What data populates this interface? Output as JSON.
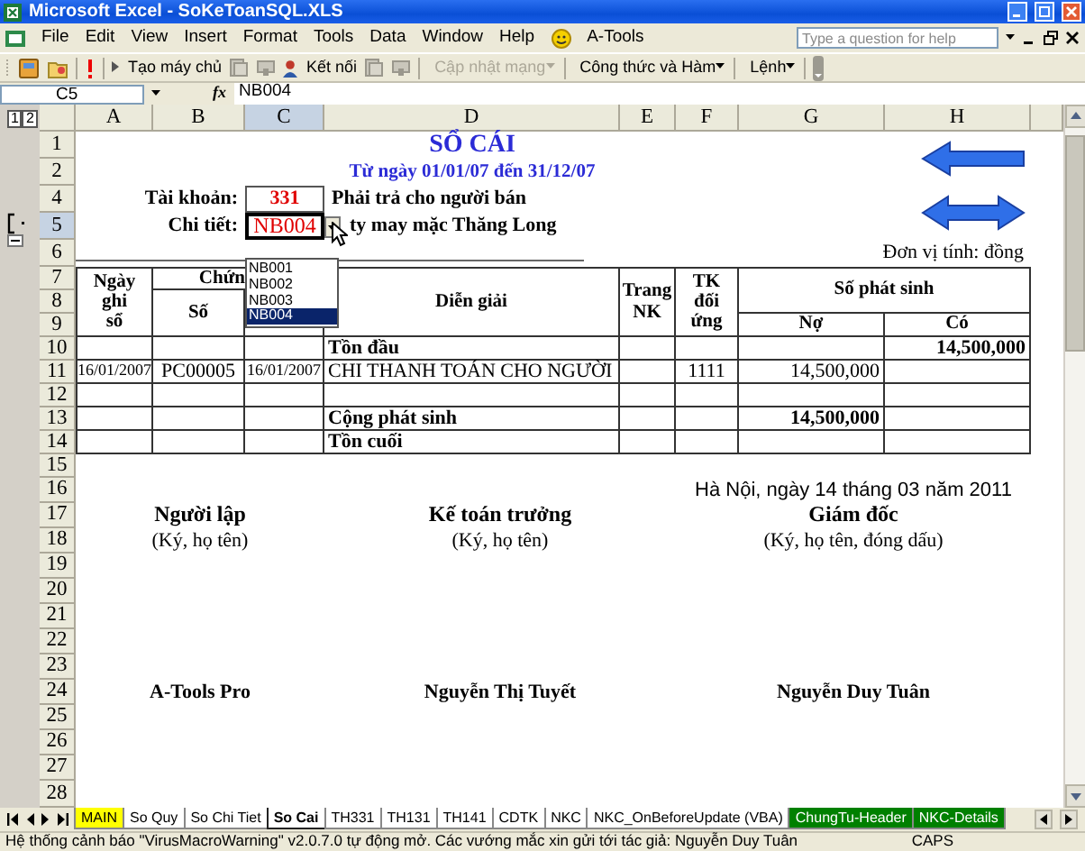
{
  "window": {
    "title": "Microsoft Excel - SoKeToanSQL.XLS"
  },
  "menu": [
    "File",
    "Edit",
    "View",
    "Insert",
    "Format",
    "Tools",
    "Data",
    "Window",
    "Help",
    "A-Tools"
  ],
  "help_box": {
    "placeholder": "Type a question for help"
  },
  "toolbar": [
    {
      "kind": "button",
      "label": "Tạo máy chủ",
      "disabled": false
    },
    {
      "kind": "button",
      "label": "Kết nối",
      "disabled": false
    },
    {
      "kind": "dropdown",
      "label": "Cập nhật mạng",
      "disabled": true
    },
    {
      "kind": "dropdown",
      "label": "Công thức và Hàm",
      "disabled": false
    },
    {
      "kind": "dropdown",
      "label": "Lệnh",
      "disabled": false
    }
  ],
  "formula_bar": {
    "name_box": "C5",
    "fx_label": "fx",
    "formula": "NB004"
  },
  "outline_levels": [
    "1",
    "2"
  ],
  "columns": [
    {
      "label": "A",
      "selected": false
    },
    {
      "label": "B",
      "selected": false
    },
    {
      "label": "C",
      "selected": true
    },
    {
      "label": "D",
      "selected": false
    },
    {
      "label": "E",
      "selected": false
    },
    {
      "label": "F",
      "selected": false
    },
    {
      "label": "G",
      "selected": false
    },
    {
      "label": "H",
      "selected": false
    }
  ],
  "rows": [
    {
      "label": "1",
      "selected": false
    },
    {
      "label": "2",
      "selected": false
    },
    {
      "label": "4",
      "selected": false
    },
    {
      "label": "5",
      "selected": true
    },
    {
      "label": "6",
      "selected": false
    },
    {
      "label": "7",
      "selected": false
    },
    {
      "label": "8",
      "selected": false
    },
    {
      "label": "9",
      "selected": false
    },
    {
      "label": "10",
      "selected": false
    },
    {
      "label": "11",
      "selected": false
    },
    {
      "label": "12",
      "selected": false
    },
    {
      "label": "13",
      "selected": false
    },
    {
      "label": "14",
      "selected": false
    },
    {
      "label": "15",
      "selected": false
    },
    {
      "label": "16",
      "selected": false
    },
    {
      "label": "17",
      "selected": false
    },
    {
      "label": "18",
      "selected": false
    },
    {
      "label": "19",
      "selected": false
    },
    {
      "label": "20",
      "selected": false
    },
    {
      "label": "21",
      "selected": false
    },
    {
      "label": "22",
      "selected": false
    },
    {
      "label": "23",
      "selected": false
    },
    {
      "label": "24",
      "selected": false
    },
    {
      "label": "25",
      "selected": false
    },
    {
      "label": "26",
      "selected": false
    },
    {
      "label": "27",
      "selected": false
    },
    {
      "label": "28",
      "selected": false
    }
  ],
  "report": {
    "title": "SỔ CÁI",
    "period": "Từ ngày 01/01/07 đến 31/12/07",
    "account": {
      "label": "Tài khoản:",
      "code": "331",
      "name": "Phải trả cho người bán"
    },
    "detail": {
      "label": "Chi tiết:",
      "code": "NB004",
      "name": "ty may mặc Thăng Long"
    },
    "unit": "Đơn vị tính: đồng",
    "headers": {
      "posting_date": "Ngày ghi sổ",
      "voucher": "Chứn",
      "voucher_no": "Số",
      "description": "Diễn giải",
      "journal_page": "Trang NK",
      "contra_account": "TK đối ứng",
      "amount": "Số phát sinh",
      "debit": "Nợ",
      "credit": "Có"
    },
    "lines": [
      {
        "kind": "summary",
        "description": "Tồn đầu",
        "credit": "14,500,000"
      },
      {
        "kind": "entry",
        "posting_date": "16/01/2007",
        "voucher_no": "PC00005",
        "voucher_date": "16/01/2007",
        "description": "CHI THANH TOÁN CHO NGƯỜI",
        "contra_account": "1111",
        "debit": "14,500,000"
      },
      {
        "kind": "blank"
      },
      {
        "kind": "summary",
        "description": "Cộng phát sinh",
        "debit": "14,500,000"
      },
      {
        "kind": "summary",
        "description": "Tồn cuối"
      }
    ],
    "date_line": "Hà Nội, ngày 14 tháng 03 năm 2011",
    "signers": [
      {
        "role": "Người lập",
        "note": "(Ký, họ tên)",
        "name": "A-Tools Pro"
      },
      {
        "role": "Kế toán trưởng",
        "note": "(Ký, họ tên)",
        "name": "Nguyễn Thị Tuyết"
      },
      {
        "role": "Giám đốc",
        "note": "(Ký, họ tên, đóng dấu)",
        "name": "Nguyễn Duy Tuân"
      }
    ]
  },
  "dropdown": {
    "items": [
      {
        "label": "NB001",
        "selected": false
      },
      {
        "label": "NB002",
        "selected": false
      },
      {
        "label": "NB003",
        "selected": false
      },
      {
        "label": "NB004",
        "selected": true
      }
    ]
  },
  "sheet_tabs": [
    {
      "label": "MAIN",
      "selected": false,
      "color": "#ffff00"
    },
    {
      "label": "So Quy",
      "selected": false
    },
    {
      "label": "So Chi Tiet",
      "selected": false
    },
    {
      "label": "So Cai",
      "selected": true
    },
    {
      "label": "TH331",
      "selected": false
    },
    {
      "label": "TH131",
      "selected": false
    },
    {
      "label": "TH141",
      "selected": false
    },
    {
      "label": "CDTK",
      "selected": false
    },
    {
      "label": "NKC",
      "selected": false
    },
    {
      "label": "NKC_OnBeforeUpdate (VBA)",
      "selected": false
    },
    {
      "label": "ChungTu-Header",
      "selected": false,
      "color": "#008000"
    },
    {
      "label": "NKC-Details",
      "selected": false,
      "color": "#008000"
    }
  ],
  "status_bar": {
    "message": "Hệ thống cảnh báo \"VirusMacroWarning\" v2.0.7.0 tự động mở. Các vướng mắc xin gửi tới tác giả: Nguyễn Duy Tuân",
    "caps": "CAPS"
  }
}
